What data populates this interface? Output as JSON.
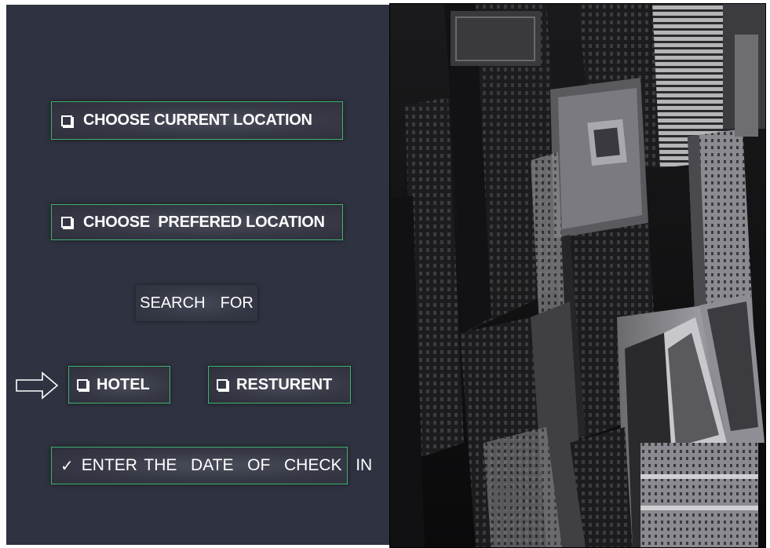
{
  "options": {
    "current_location": "CHOOSE CURRENT LOCATION",
    "prefered_location": "CHOOSE  PREFERED LOCATION",
    "search_for": "SEARCH  FOR",
    "hotel": "HOTEL",
    "resturent": "RESTURENT",
    "check_in": "ENTER THE  DATE  OF  CHECK  IN",
    "check_mark": "✓"
  },
  "icons": {
    "checkbox": "checkbox-icon",
    "arrow": "right-arrow-icon"
  },
  "colors": {
    "panel": "#2f3240",
    "button_border": "#3fb26e",
    "text": "#ffffff",
    "photo_dark": "#0c0c0d"
  }
}
